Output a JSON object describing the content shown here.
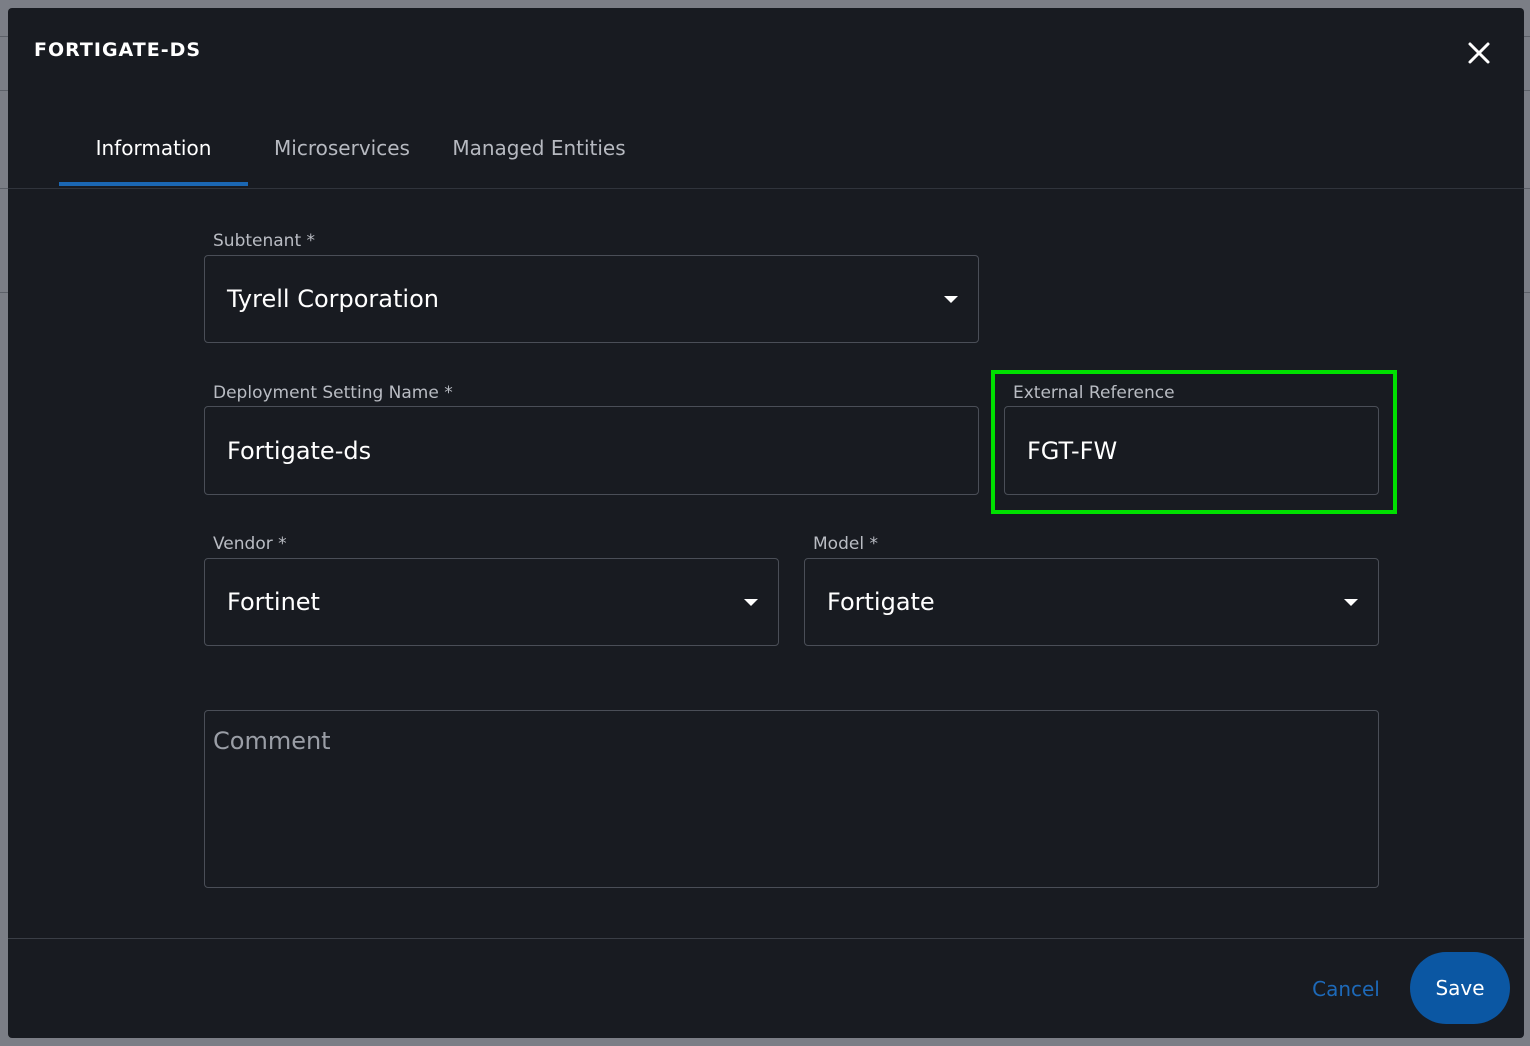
{
  "dialog": {
    "title": "FORTIGATE-DS"
  },
  "tabs": [
    {
      "label": "Information",
      "active": true
    },
    {
      "label": "Microservices",
      "active": false
    },
    {
      "label": "Managed Entities",
      "active": false
    }
  ],
  "form": {
    "subtenant": {
      "label": "Subtenant *",
      "value": "Tyrell Corporation"
    },
    "deployment_setting_name": {
      "label": "Deployment Setting Name *",
      "value": "Fortigate-ds"
    },
    "external_reference": {
      "label": "External Reference",
      "value": "FGT-FW"
    },
    "vendor": {
      "label": "Vendor *",
      "value": "Fortinet"
    },
    "model": {
      "label": "Model *",
      "value": "Fortigate"
    },
    "comment": {
      "placeholder": "Comment",
      "value": ""
    }
  },
  "footer": {
    "cancel_label": "Cancel",
    "save_label": "Save"
  },
  "colors": {
    "accent": "#0b57a3",
    "highlight": "#00e000",
    "dialog_bg": "#181b21"
  },
  "icons": {
    "close": "close-icon",
    "dropdown": "chevron-down-icon"
  }
}
